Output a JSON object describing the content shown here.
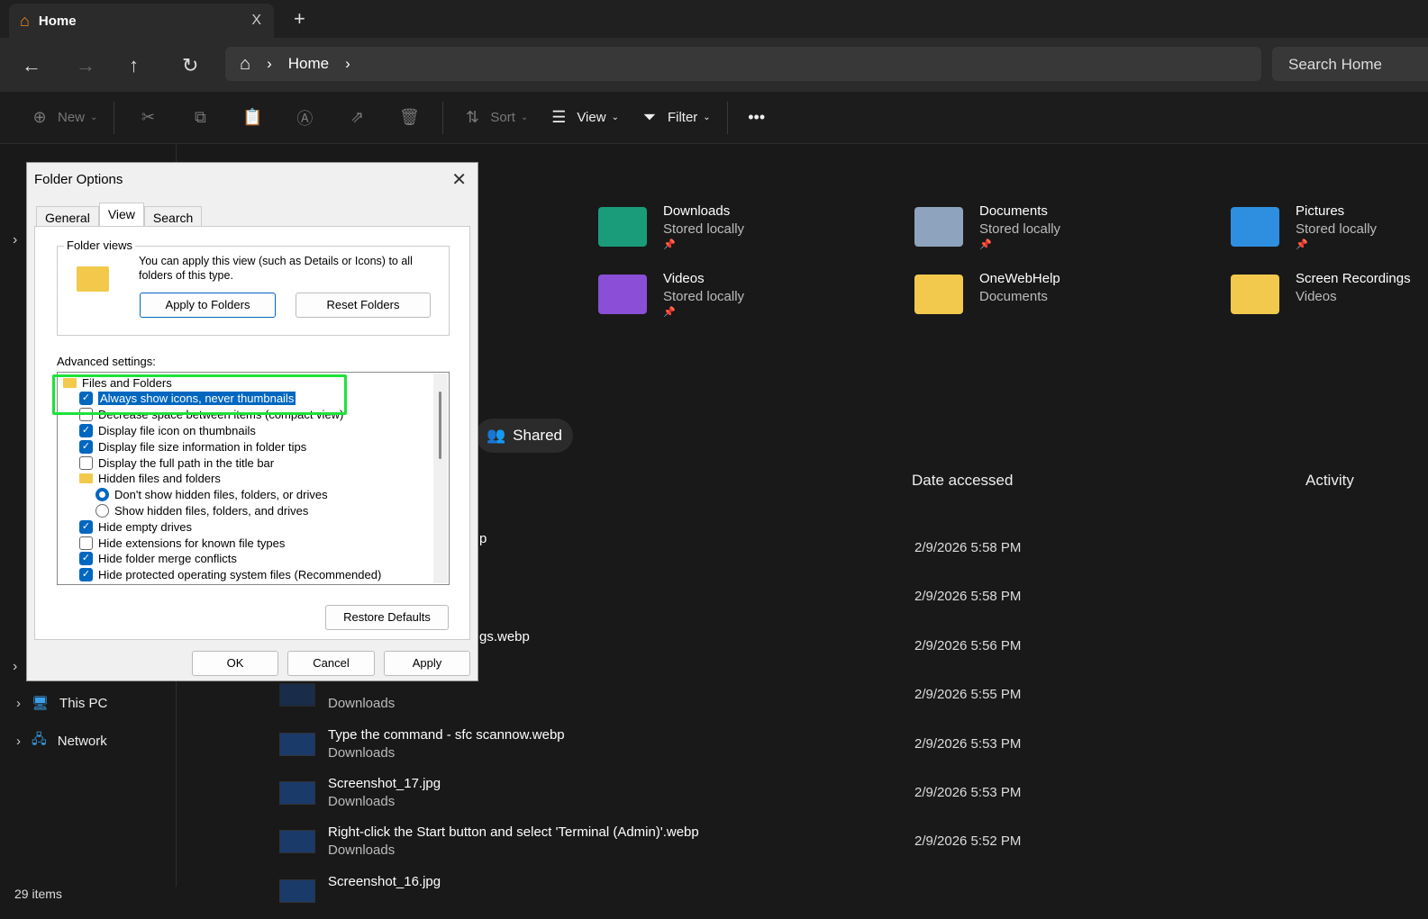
{
  "tab": {
    "title": "Home",
    "close": "X",
    "new": "+"
  },
  "nav": {
    "back": "←",
    "forward": "→",
    "up": "↑",
    "refresh": "↻",
    "breadcrumb": "Home",
    "search_placeholder": "Search Home"
  },
  "toolbar": [
    {
      "label": "New",
      "icon": "plus-circle-icon",
      "glyph": "⊕",
      "dim": true,
      "caret": true
    },
    {
      "sep": true
    },
    {
      "label": "",
      "icon": "cut-icon",
      "glyph": "✂",
      "dim": true
    },
    {
      "label": "",
      "icon": "copy-icon",
      "glyph": "⧉",
      "dim": true
    },
    {
      "label": "",
      "icon": "paste-icon",
      "glyph": "📋",
      "dim": true
    },
    {
      "label": "",
      "icon": "rename-icon",
      "glyph": "Ⓐ",
      "dim": true
    },
    {
      "label": "",
      "icon": "share-icon",
      "glyph": "⇗",
      "dim": true
    },
    {
      "label": "",
      "icon": "delete-icon",
      "glyph": "🗑",
      "dim": true
    },
    {
      "sep": true
    },
    {
      "label": "Sort",
      "icon": "sort-icon",
      "glyph": "⇅",
      "dim": true,
      "caret": true
    },
    {
      "label": "View",
      "icon": "view-icon",
      "glyph": "☰",
      "caret": true
    },
    {
      "label": "Filter",
      "icon": "filter-icon",
      "glyph": "⏷",
      "caret": true
    },
    {
      "sep": true
    },
    {
      "label": "",
      "icon": "more-icon",
      "glyph": "•••"
    }
  ],
  "sidebar": [
    {
      "label": "This PC",
      "icon": "computer-icon"
    },
    {
      "label": "Network",
      "icon": "network-icon"
    }
  ],
  "quick_access": [
    {
      "name": "Downloads",
      "sub": "Stored locally",
      "pinned": true,
      "color": "#1a9c7a"
    },
    {
      "name": "Documents",
      "sub": "Stored locally",
      "pinned": true,
      "color": "#8ea3bd"
    },
    {
      "name": "Pictures",
      "sub": "Stored locally",
      "pinned": true,
      "color": "#2e8fe0"
    },
    {
      "name": "Videos",
      "sub": "Stored locally",
      "pinned": true,
      "color": "#8a4fd6"
    },
    {
      "name": "OneWebHelp",
      "sub": "Documents",
      "pinned": false,
      "color": "#f2c94c"
    },
    {
      "name": "Screen Recordings",
      "sub": "Videos",
      "pinned": false,
      "color": "#f2c94c"
    }
  ],
  "shared_label": "Shared",
  "columns": {
    "date": "Date accessed",
    "activity": "Activity"
  },
  "files": [
    {
      "name": "p",
      "location": "",
      "date": "2/9/2026 5:58 PM",
      "partial": true
    },
    {
      "name": "",
      "location": "",
      "date": "2/9/2026 5:58 PM",
      "partial": true
    },
    {
      "name": "gs.webp",
      "location": "",
      "date": "2/9/2026 5:56 PM",
      "partial": true
    },
    {
      "name": "",
      "location": "Downloads",
      "date": "2/9/2026 5:55 PM",
      "partial": true
    },
    {
      "name": "Type the command - sfc scannow.webp",
      "location": "Downloads",
      "date": "2/9/2026 5:53 PM"
    },
    {
      "name": "Screenshot_17.jpg",
      "location": "Downloads",
      "date": "2/9/2026 5:53 PM"
    },
    {
      "name": "Right-click the Start button and select 'Terminal (Admin)'.webp",
      "location": "Downloads",
      "date": "2/9/2026 5:52 PM"
    },
    {
      "name": "Screenshot_16.jpg",
      "location": "",
      "date": ""
    }
  ],
  "status": "29 items",
  "dialog": {
    "title": "Folder Options",
    "tabs": [
      "General",
      "View",
      "Search"
    ],
    "active_tab": "View",
    "folder_views": {
      "label": "Folder views",
      "text": "You can apply this view (such as Details or Icons) to all folders of this type.",
      "apply": "Apply to Folders",
      "reset": "Reset Folders"
    },
    "advanced_label": "Advanced settings:",
    "settings": [
      {
        "type": "folder",
        "label": "Files and Folders",
        "level": 0
      },
      {
        "type": "check",
        "label": "Always show icons, never thumbnails",
        "checked": true,
        "selected": true,
        "level": 1
      },
      {
        "type": "check",
        "label": "Decrease space between items (compact view)",
        "checked": false,
        "level": 1
      },
      {
        "type": "check",
        "label": "Display file icon on thumbnails",
        "checked": true,
        "level": 1
      },
      {
        "type": "check",
        "label": "Display file size information in folder tips",
        "checked": true,
        "level": 1
      },
      {
        "type": "check",
        "label": "Display the full path in the title bar",
        "checked": false,
        "level": 1
      },
      {
        "type": "folder",
        "label": "Hidden files and folders",
        "level": 1
      },
      {
        "type": "radio",
        "label": "Don't show hidden files, folders, or drives",
        "checked": true,
        "level": 2
      },
      {
        "type": "radio",
        "label": "Show hidden files, folders, and drives",
        "checked": false,
        "level": 2
      },
      {
        "type": "check",
        "label": "Hide empty drives",
        "checked": true,
        "level": 1
      },
      {
        "type": "check",
        "label": "Hide extensions for known file types",
        "checked": false,
        "level": 1
      },
      {
        "type": "check",
        "label": "Hide folder merge conflicts",
        "checked": true,
        "level": 1
      },
      {
        "type": "check",
        "label": "Hide protected operating system files (Recommended)",
        "checked": true,
        "level": 1
      },
      {
        "type": "check",
        "label": "",
        "checked": true,
        "level": 1
      }
    ],
    "restore": "Restore Defaults",
    "ok": "OK",
    "cancel": "Cancel",
    "apply": "Apply"
  }
}
